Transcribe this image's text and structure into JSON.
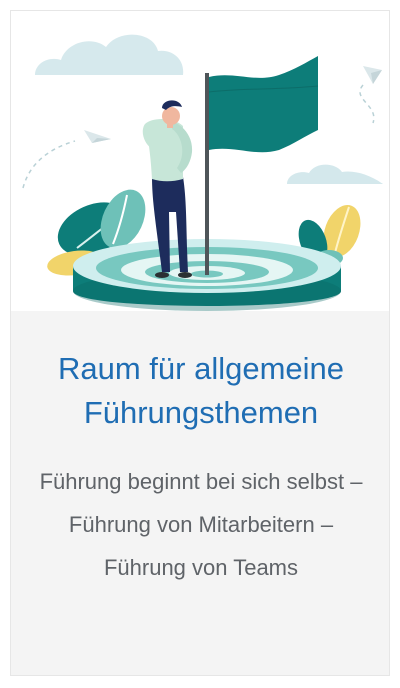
{
  "card": {
    "title": "Raum für allgemeine Führungsthemen",
    "description": "Führung beginnt bei sich selbst – Führung von Mitarbeitern – Führung von Teams"
  },
  "colors": {
    "title": "#1f6db3",
    "text": "#5f6368",
    "card_background": "#f4f4f4",
    "teal_dark": "#0d7d79",
    "teal_light": "#78c8c0",
    "sky": "#cfe5ea",
    "leaf_yellow": "#f1d46a"
  },
  "illustration": {
    "icons": [
      "cloud-icon",
      "paper-plane-icon",
      "flag-icon",
      "person-icon",
      "target-icon",
      "leaf-icon"
    ]
  }
}
